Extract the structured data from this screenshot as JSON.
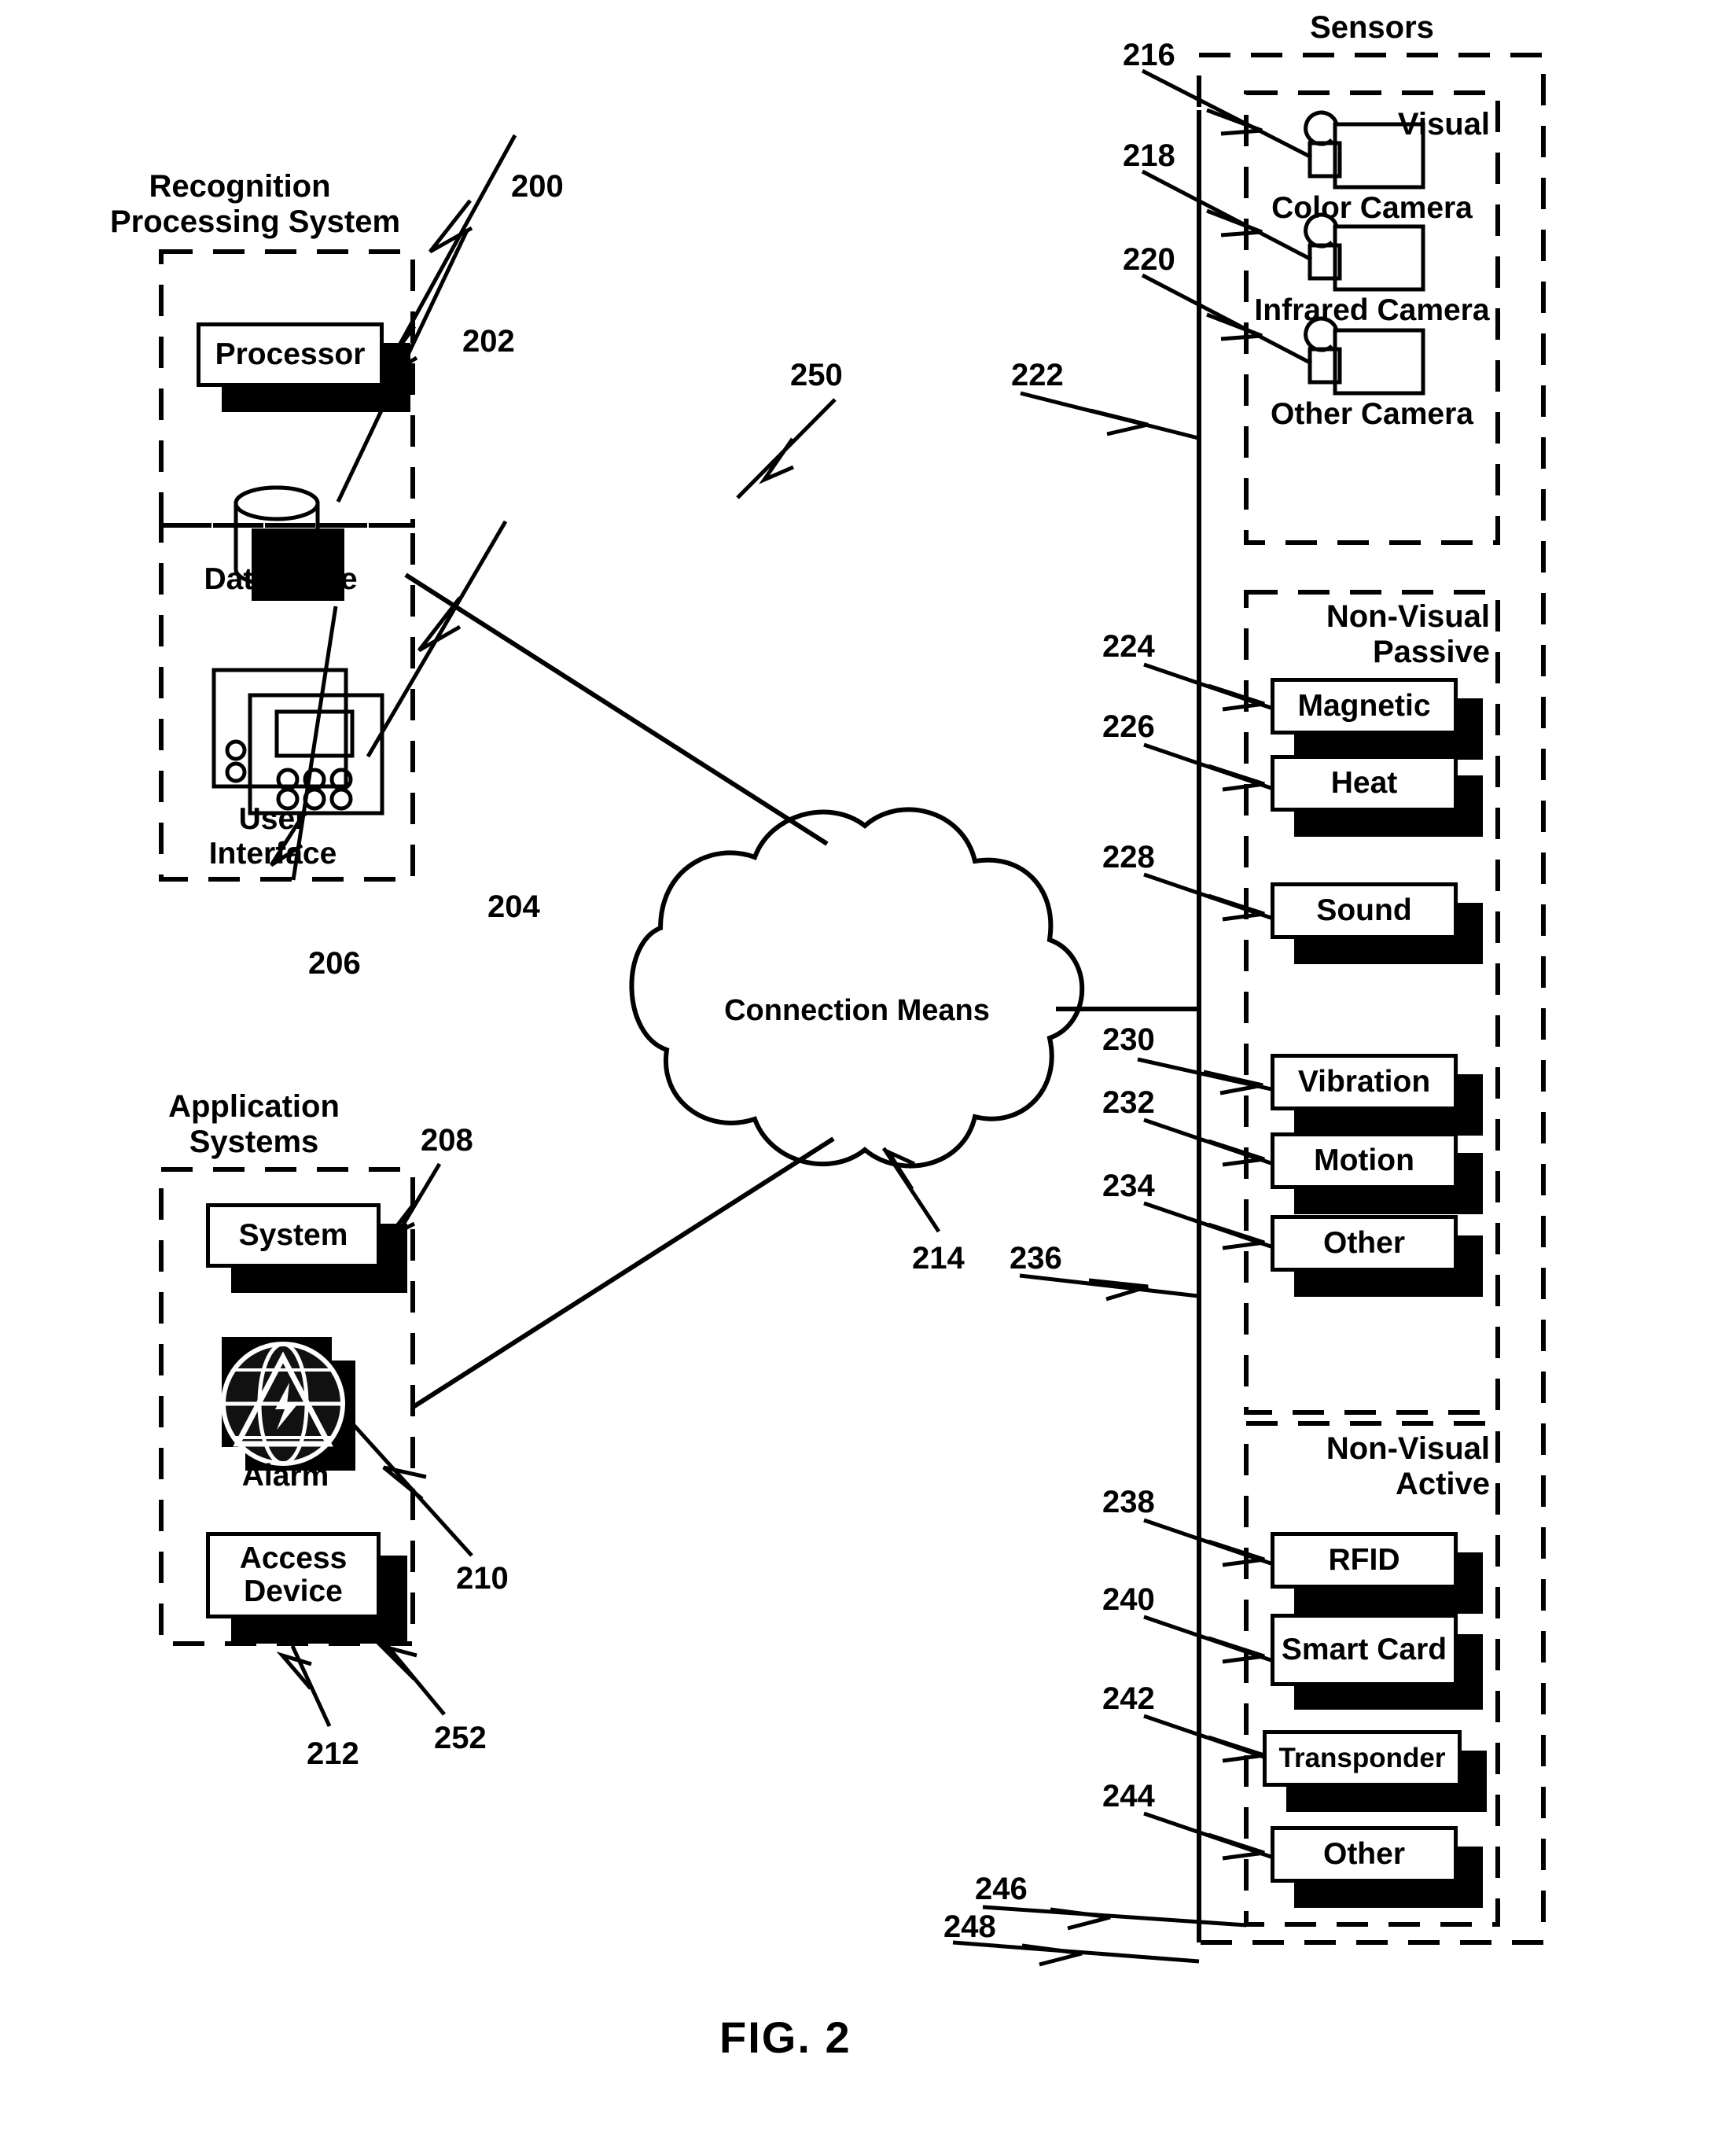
{
  "figure": {
    "caption": "FIG. 2"
  },
  "groups": {
    "recognition": {
      "title": "Recognition\nProcessing System",
      "nodes": [
        {
          "label": "Processor",
          "ref": "200"
        },
        {
          "label": "Data Store",
          "ref": "202"
        },
        {
          "label": "User\nInterface",
          "ref": "204"
        }
      ],
      "group_ref": "206"
    },
    "application": {
      "title": "Application\nSystems",
      "nodes": [
        {
          "label": "System",
          "ref": "208"
        },
        {
          "label": "Alarm",
          "ref": "210"
        },
        {
          "label": "Access\nDevice",
          "ref": "252"
        }
      ],
      "group_ref": "212"
    },
    "cloud": {
      "label": "Connection Means",
      "ref": "214",
      "free_ref": "250"
    },
    "sensors": {
      "title": "Sensors",
      "group_ref": "248",
      "subgroups": [
        {
          "title": "Visual",
          "group_ref": "222",
          "nodes": [
            {
              "label": "Color Camera",
              "ref": "216",
              "icon": "camera-icon"
            },
            {
              "label": "Infrared Camera",
              "ref": "218",
              "icon": "camera-icon"
            },
            {
              "label": "Other Camera",
              "ref": "220",
              "icon": "camera-icon"
            }
          ]
        },
        {
          "title": "Non-Visual\nPassive",
          "group_ref": "236",
          "nodes": [
            {
              "label": "Magnetic",
              "ref": "224"
            },
            {
              "label": "Heat",
              "ref": "226"
            },
            {
              "label": "Sound",
              "ref": "228"
            },
            {
              "label": "Vibration",
              "ref": "230"
            },
            {
              "label": "Motion",
              "ref": "232"
            },
            {
              "label": "Other",
              "ref": "234"
            }
          ]
        },
        {
          "title": "Non-Visual\nActive",
          "group_ref": "246",
          "nodes": [
            {
              "label": "RFID",
              "ref": "238"
            },
            {
              "label": "Smart\nCard",
              "ref": "240"
            },
            {
              "label": "Transponder",
              "ref": "242"
            },
            {
              "label": "Other",
              "ref": "244"
            }
          ]
        }
      ]
    }
  },
  "colors": {
    "ink": "#000000",
    "paper": "#ffffff"
  }
}
